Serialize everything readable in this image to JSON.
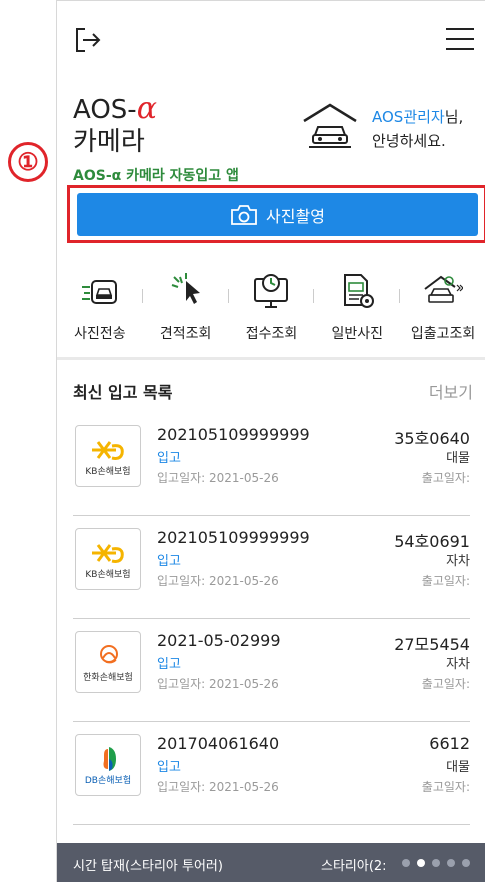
{
  "marker": {
    "step": "①"
  },
  "header": {
    "logout_icon": "logout-icon",
    "menu_icon": "hamburger-menu-icon"
  },
  "app": {
    "title_prefix": "AOS-",
    "title_alpha": "α",
    "title_line2": "카메라",
    "subtitle": "AOS-α 카메라 자동입고 앱"
  },
  "user": {
    "admin_name": "AOS관리자",
    "honorific": "님,",
    "greeting": "안녕하세요."
  },
  "camera_button": {
    "label": "사진촬영",
    "icon": "camera-icon"
  },
  "quick_menu": [
    {
      "label": "사진전송",
      "icon": "photo-send-icon"
    },
    {
      "label": "견적조회",
      "icon": "estimate-click-icon"
    },
    {
      "label": "접수조회",
      "icon": "reception-clock-icon"
    },
    {
      "label": "일반사진",
      "icon": "document-photo-icon"
    },
    {
      "label": "입출고조회",
      "icon": "garage-search-icon"
    }
  ],
  "section": {
    "title": "최신 입고 목록",
    "more": "더보기"
  },
  "entries": [
    {
      "logo": "KB손해보험",
      "id": "202105109999999",
      "status": "입고",
      "date": "입고일자: 2021-05-26",
      "plate": "35호0640",
      "type": "대물",
      "out": "출고일자:"
    },
    {
      "logo": "KB손해보험",
      "id": "202105109999999",
      "status": "입고",
      "date": "입고일자: 2021-05-26",
      "plate": "54호0691",
      "type": "자차",
      "out": "출고일자:"
    },
    {
      "logo": "한화손해보험",
      "id": "2021-05-02999",
      "status": "입고",
      "date": "입고일자: 2021-05-26",
      "plate": "27모5454",
      "type": "자차",
      "out": "출고일자:"
    },
    {
      "logo": "DB손해보험",
      "id": "201704061640",
      "status": "입고",
      "date": "입고일자: 2021-05-26",
      "plate": "6612",
      "type": "대물",
      "out": "출고일자:"
    }
  ],
  "ticker": {
    "left_text": "시간 탑재(스타리아 투어러)",
    "right_text": "스타리아(2:",
    "dot_count": 5,
    "active_dot": 1
  },
  "colors": {
    "accent_blue": "#1e88e5",
    "highlight_red": "#e0242a",
    "subtitle_green": "#2e8b3c",
    "ticker_bg": "#565b68"
  }
}
